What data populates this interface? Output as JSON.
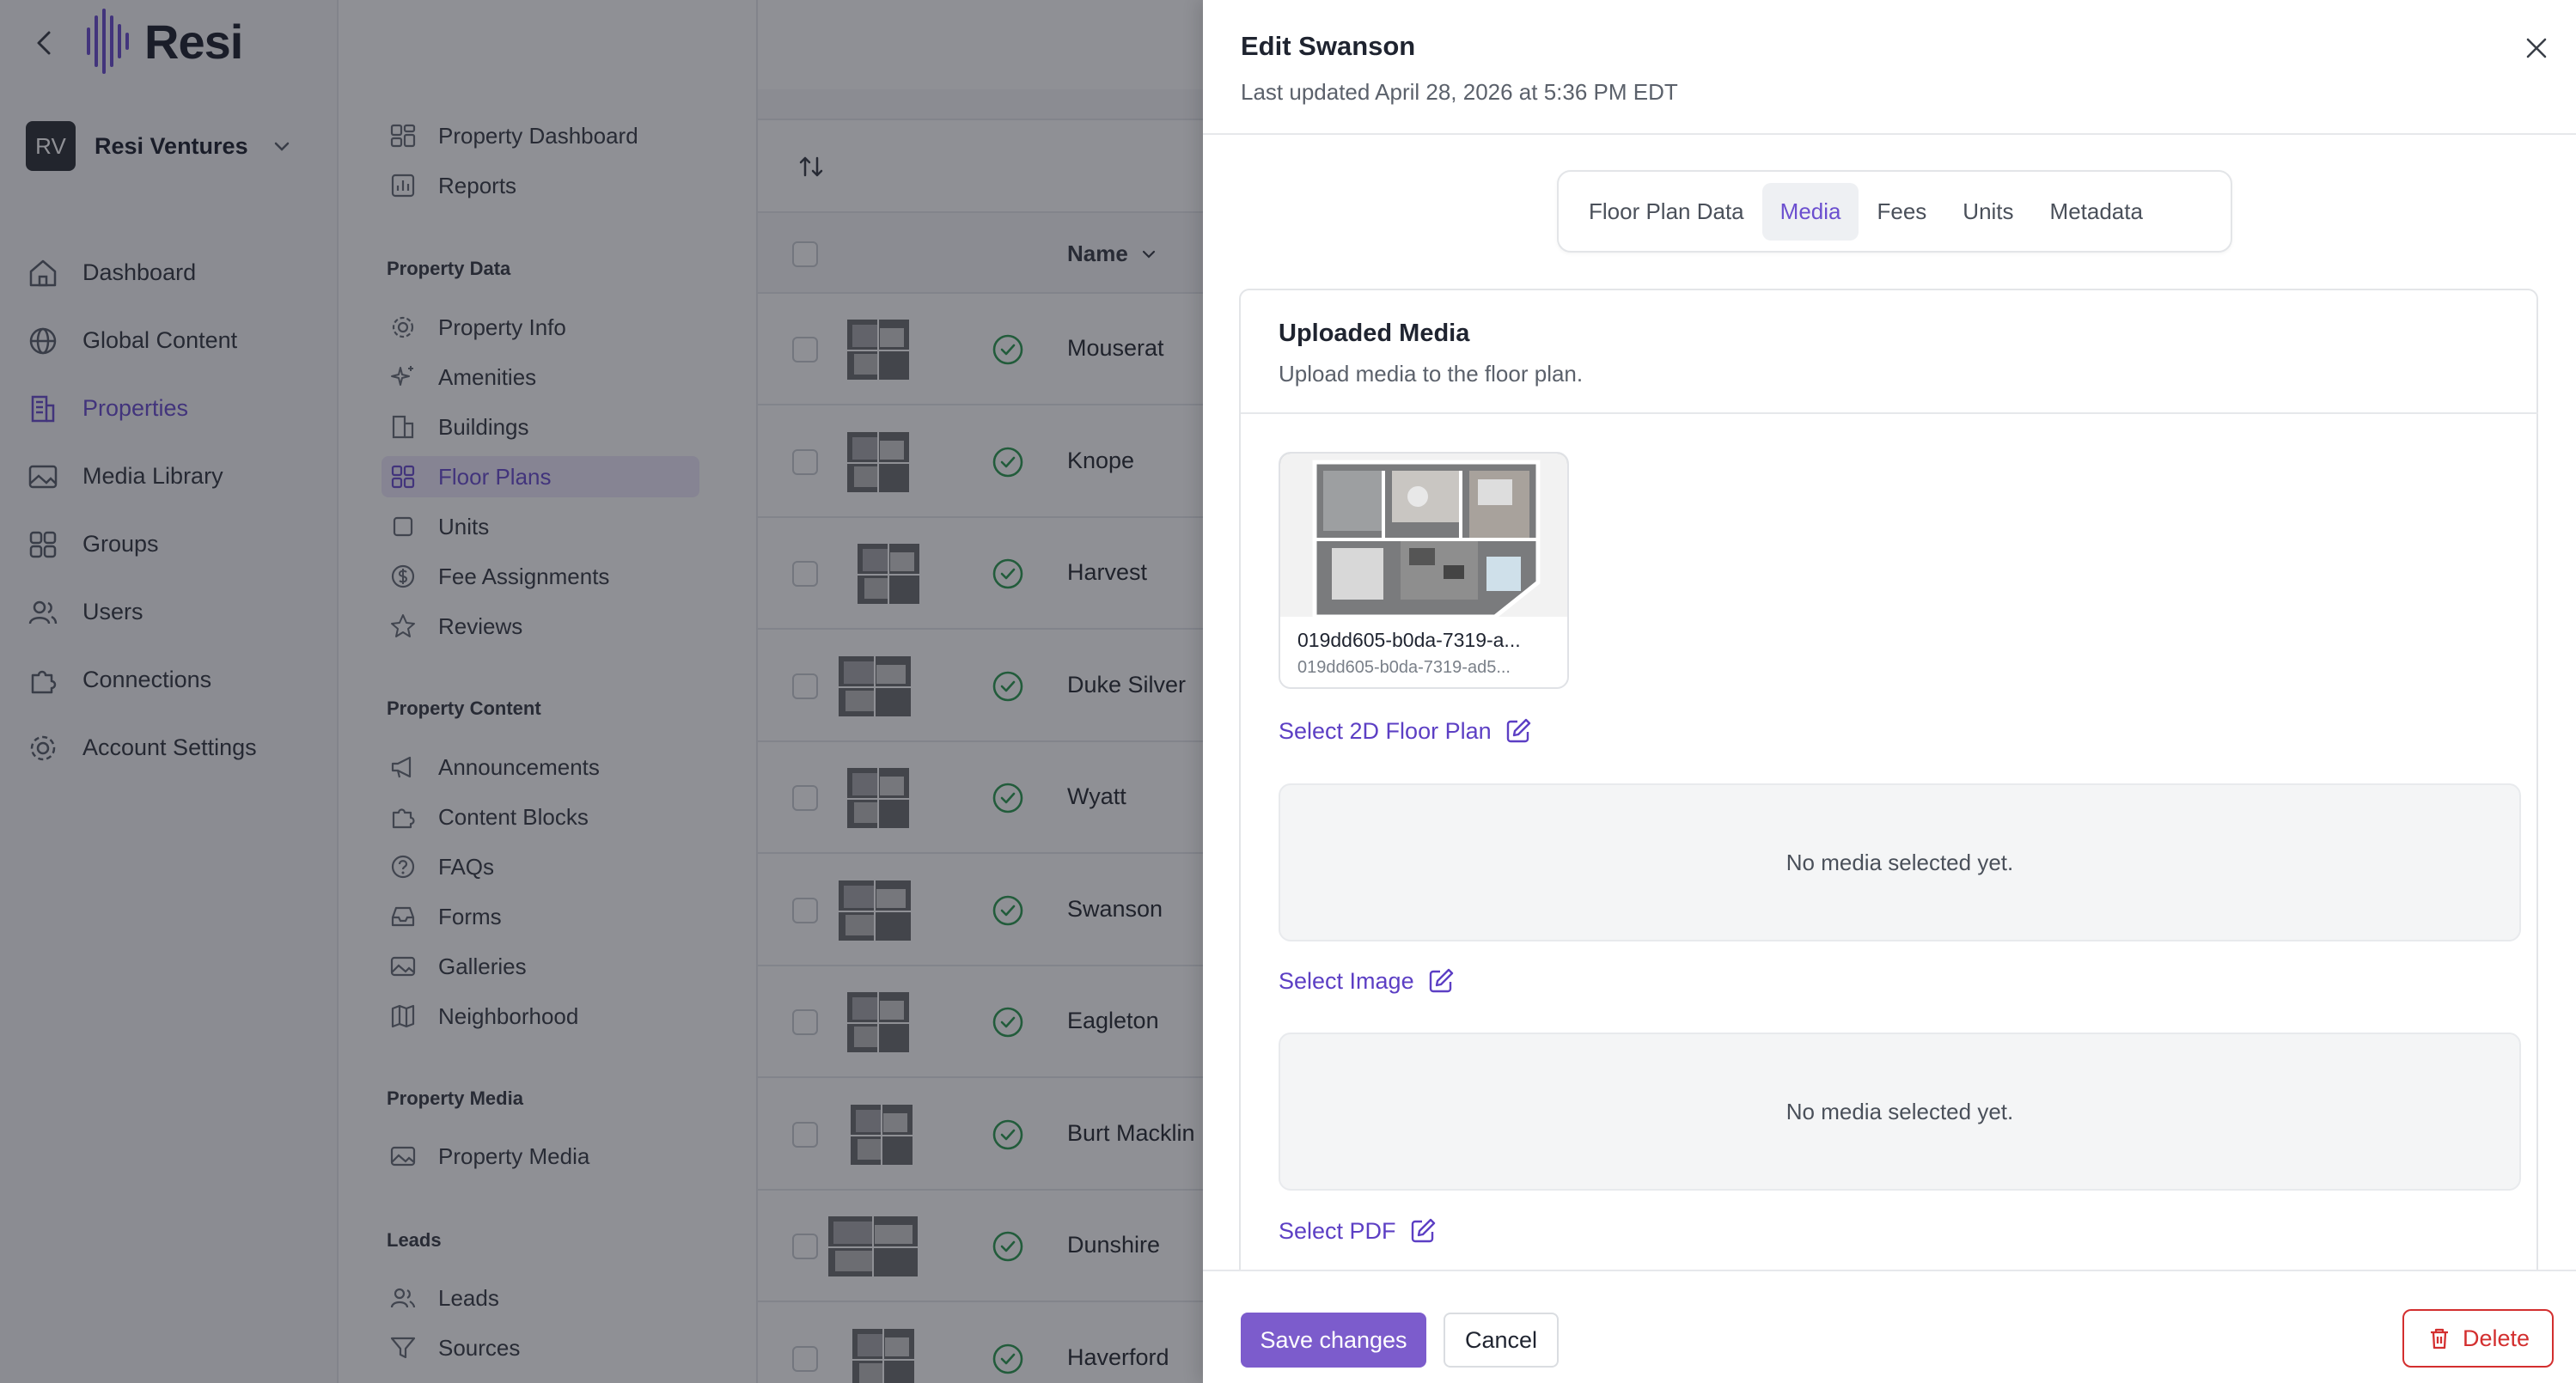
{
  "app": {
    "logo_text": "Resi"
  },
  "org": {
    "initials": "RV",
    "name": "Resi Ventures"
  },
  "main_nav": [
    {
      "label": "Dashboard",
      "icon": "home-icon",
      "active": false
    },
    {
      "label": "Global Content",
      "icon": "globe-icon",
      "active": false
    },
    {
      "label": "Properties",
      "icon": "building-icon",
      "active": true
    },
    {
      "label": "Media Library",
      "icon": "image-icon",
      "active": false
    },
    {
      "label": "Groups",
      "icon": "grid-icon",
      "active": false
    },
    {
      "label": "Users",
      "icon": "users-icon",
      "active": false
    },
    {
      "label": "Connections",
      "icon": "puzzle-icon",
      "active": false
    },
    {
      "label": "Account Settings",
      "icon": "gear-icon",
      "active": false
    }
  ],
  "section_nav": {
    "top_items": [
      {
        "label": "Property Dashboard",
        "icon": "dashboard-icon"
      },
      {
        "label": "Reports",
        "icon": "chart-icon"
      }
    ],
    "groups": [
      {
        "heading": "Property Data",
        "items": [
          {
            "label": "Property Info",
            "icon": "gear-icon"
          },
          {
            "label": "Amenities",
            "icon": "sparkle-icon"
          },
          {
            "label": "Buildings",
            "icon": "building-icon"
          },
          {
            "label": "Floor Plans",
            "icon": "grid-icon",
            "active": true
          },
          {
            "label": "Units",
            "icon": "square-icon"
          },
          {
            "label": "Fee Assignments",
            "icon": "dollar-icon"
          },
          {
            "label": "Reviews",
            "icon": "star-icon"
          }
        ]
      },
      {
        "heading": "Property Content",
        "items": [
          {
            "label": "Announcements",
            "icon": "megaphone-icon"
          },
          {
            "label": "Content Blocks",
            "icon": "puzzle-icon"
          },
          {
            "label": "FAQs",
            "icon": "question-icon"
          },
          {
            "label": "Forms",
            "icon": "inbox-icon"
          },
          {
            "label": "Galleries",
            "icon": "image-icon"
          },
          {
            "label": "Neighborhood",
            "icon": "map-icon"
          }
        ]
      },
      {
        "heading": "Property Media",
        "items": [
          {
            "label": "Property Media",
            "icon": "image-icon"
          }
        ]
      },
      {
        "heading": "Leads",
        "items": [
          {
            "label": "Leads",
            "icon": "users-icon"
          },
          {
            "label": "Sources",
            "icon": "filter-icon"
          }
        ]
      }
    ]
  },
  "table": {
    "column_name": "Name",
    "rows": [
      {
        "name": "Mouserat",
        "status": "active"
      },
      {
        "name": "Knope",
        "status": "active"
      },
      {
        "name": "Harvest",
        "status": "active"
      },
      {
        "name": "Duke Silver",
        "status": "active"
      },
      {
        "name": "Wyatt",
        "status": "active"
      },
      {
        "name": "Swanson",
        "status": "active"
      },
      {
        "name": "Eagleton",
        "status": "active"
      },
      {
        "name": "Burt Macklin",
        "status": "active"
      },
      {
        "name": "Dunshire",
        "status": "active"
      },
      {
        "name": "Haverford",
        "status": "active"
      }
    ]
  },
  "drawer": {
    "title": "Edit Swanson",
    "subtitle": "Last updated April 28, 2026 at 5:36 PM EDT",
    "tabs": [
      {
        "label": "Floor Plan Data",
        "active": false
      },
      {
        "label": "Media",
        "active": true
      },
      {
        "label": "Fees",
        "active": false
      },
      {
        "label": "Units",
        "active": false
      },
      {
        "label": "Metadata",
        "active": false
      }
    ],
    "card": {
      "title": "Uploaded Media",
      "subtitle": "Upload media to the floor plan.",
      "media_file": {
        "name": "019dd605-b0da-7319-a...",
        "id": "019dd605-b0da-7319-ad5..."
      },
      "select_floor_plan": "Select 2D Floor Plan",
      "empty_image": "No media selected yet.",
      "select_image": "Select Image",
      "empty_pdf": "No media selected yet.",
      "select_pdf": "Select PDF"
    },
    "footer": {
      "save": "Save changes",
      "cancel": "Cancel",
      "delete": "Delete"
    }
  },
  "colors": {
    "accent": "#6b4fcf",
    "danger": "#d32f2f",
    "success": "#2e9b54",
    "overlay": "rgba(20,24,33,0.48)"
  }
}
